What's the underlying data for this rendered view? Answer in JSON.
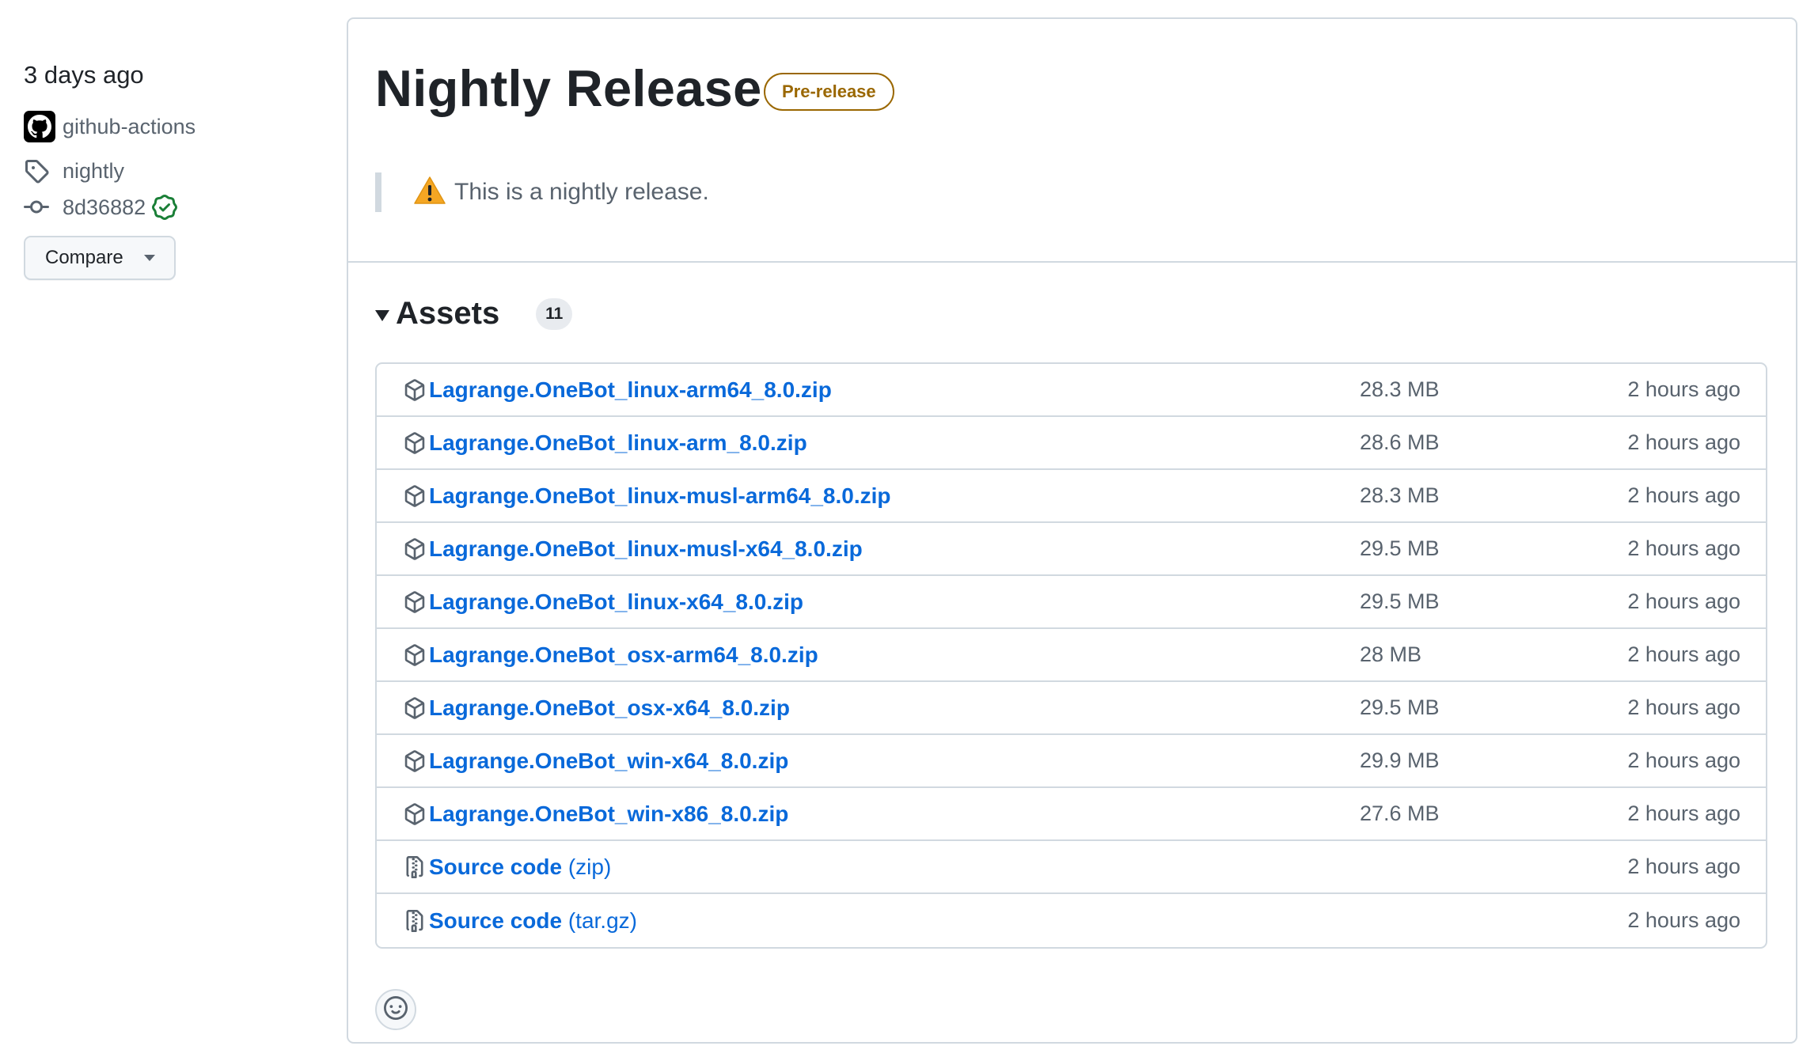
{
  "sidebar": {
    "date": "3 days ago",
    "author": "github-actions",
    "tag": "nightly",
    "commit": "8d36882",
    "compare_label": "Compare"
  },
  "release": {
    "title": "Nightly Release",
    "badge": "Pre-release",
    "notice": "This is a nightly release."
  },
  "assets": {
    "title": "Assets",
    "count": "11",
    "items": [
      {
        "name": "Lagrange.OneBot_linux-arm64_8.0.zip",
        "size": "28.3 MB",
        "time": "2 hours ago"
      },
      {
        "name": "Lagrange.OneBot_linux-arm_8.0.zip",
        "size": "28.6 MB",
        "time": "2 hours ago"
      },
      {
        "name": "Lagrange.OneBot_linux-musl-arm64_8.0.zip",
        "size": "28.3 MB",
        "time": "2 hours ago"
      },
      {
        "name": "Lagrange.OneBot_linux-musl-x64_8.0.zip",
        "size": "29.5 MB",
        "time": "2 hours ago"
      },
      {
        "name": "Lagrange.OneBot_linux-x64_8.0.zip",
        "size": "29.5 MB",
        "time": "2 hours ago"
      },
      {
        "name": "Lagrange.OneBot_osx-arm64_8.0.zip",
        "size": "28 MB",
        "time": "2 hours ago"
      },
      {
        "name": "Lagrange.OneBot_osx-x64_8.0.zip",
        "size": "29.5 MB",
        "time": "2 hours ago"
      },
      {
        "name": "Lagrange.OneBot_win-x64_8.0.zip",
        "size": "29.9 MB",
        "time": "2 hours ago"
      },
      {
        "name": "Lagrange.OneBot_win-x86_8.0.zip",
        "size": "27.6 MB",
        "time": "2 hours ago"
      }
    ],
    "source": [
      {
        "name": "Source code",
        "format": "(zip)",
        "time": "2 hours ago"
      },
      {
        "name": "Source code",
        "format": "(tar.gz)",
        "time": "2 hours ago"
      }
    ]
  },
  "colors": {
    "link": "#0969da",
    "muted": "#59636e",
    "border": "#d1d9e0",
    "prerelease": "#9a6700",
    "verified": "#1a7f37",
    "warning": "#d29922"
  },
  "icons": {
    "avatar": "github-mark-icon",
    "tag": "tag-icon",
    "commit": "git-commit-icon",
    "verified": "verified-check-icon",
    "warning": "alert-icon",
    "package": "package-icon",
    "source": "file-zip-icon",
    "reaction": "smiley-icon"
  }
}
